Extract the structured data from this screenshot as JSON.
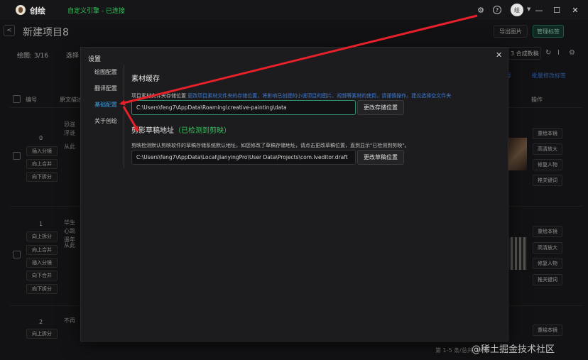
{
  "titlebar": {
    "app_name": "创绘",
    "sync_status": "自定义引擎 - 已连接",
    "avatar_text": "绘",
    "minimize": "—",
    "maximize": "☐",
    "close": "✕"
  },
  "header": {
    "back": "<",
    "project_title": "新建项目8",
    "export_label": "导出图片",
    "manage_label": "管理标签"
  },
  "toolbar": {
    "draw_count": "绘图: 3/16",
    "select_label": "选择",
    "merge_select": "3 合成数稿",
    "link_mid": "导",
    "link_right": "批量修改标签"
  },
  "table": {
    "headers": {
      "number": "编号",
      "text": "原文描述",
      "ops": "操作"
    },
    "rows": [
      {
        "number": "0",
        "side_buttons": [
          "插入分镜",
          "向上合并",
          "向下拆分"
        ],
        "text": [
          "恐滋",
          "浮涟",
          "从此"
        ],
        "ops": [
          "重绘本镜",
          "高清放大",
          "修复人物",
          "推关键词"
        ]
      },
      {
        "number": "1",
        "side_buttons": [
          "向上拆分",
          "向上合并",
          "插入分镜",
          "向下合并",
          "向下拆分"
        ],
        "text": [
          "华生",
          "心跳",
          "遥年",
          "从此"
        ],
        "ops": [
          "重绘本镜",
          "高清放大",
          "修复人物",
          "推关键词"
        ]
      },
      {
        "number": "2",
        "side_buttons": [
          "向上拆分"
        ],
        "text": [
          "不再"
        ],
        "ops": [
          "重绘本镜"
        ]
      }
    ]
  },
  "pager": "第 1-5 条/总共 16 条",
  "watermark": "@稀土掘金技术社区",
  "modal": {
    "title": "设置",
    "close": "✕",
    "menu": [
      "绘图配置",
      "翻译配置",
      "基础配置",
      "关于创绘"
    ],
    "active_menu": "基础配置",
    "material": {
      "title": "素材缓存",
      "desc_prefix": "项目素材文件夹存储位置",
      "desc_highlight": "更改项目素材文件夹的存储位置，将影响已创建的小说项目的图片、视频等素材的使用，请谨慎操作。建议选择空文件夹",
      "path": "C:\\Users\\feng7\\AppData\\Roaming\\creative-painting\\data",
      "button": "更改存储位置"
    },
    "jianying": {
      "title_prefix": "剪影草稿地址",
      "title_status": "（已检测到剪映）",
      "desc": "剪映检测默认剪映软件的草稿存储系统默认地址，如您修改了草稿存储地址，请点击更改草稿位置，直到显示\"已检测到剪映\"。",
      "path": "C:\\Users\\feng7\\AppData\\Local\\JianyingPro\\User Data\\Projects\\com.lveditor.draft",
      "button": "更改草稿位置"
    }
  },
  "colors": {
    "accent_green": "#33c25a",
    "link_blue": "#3d7bd8",
    "annotation_red": "#e8202a"
  }
}
